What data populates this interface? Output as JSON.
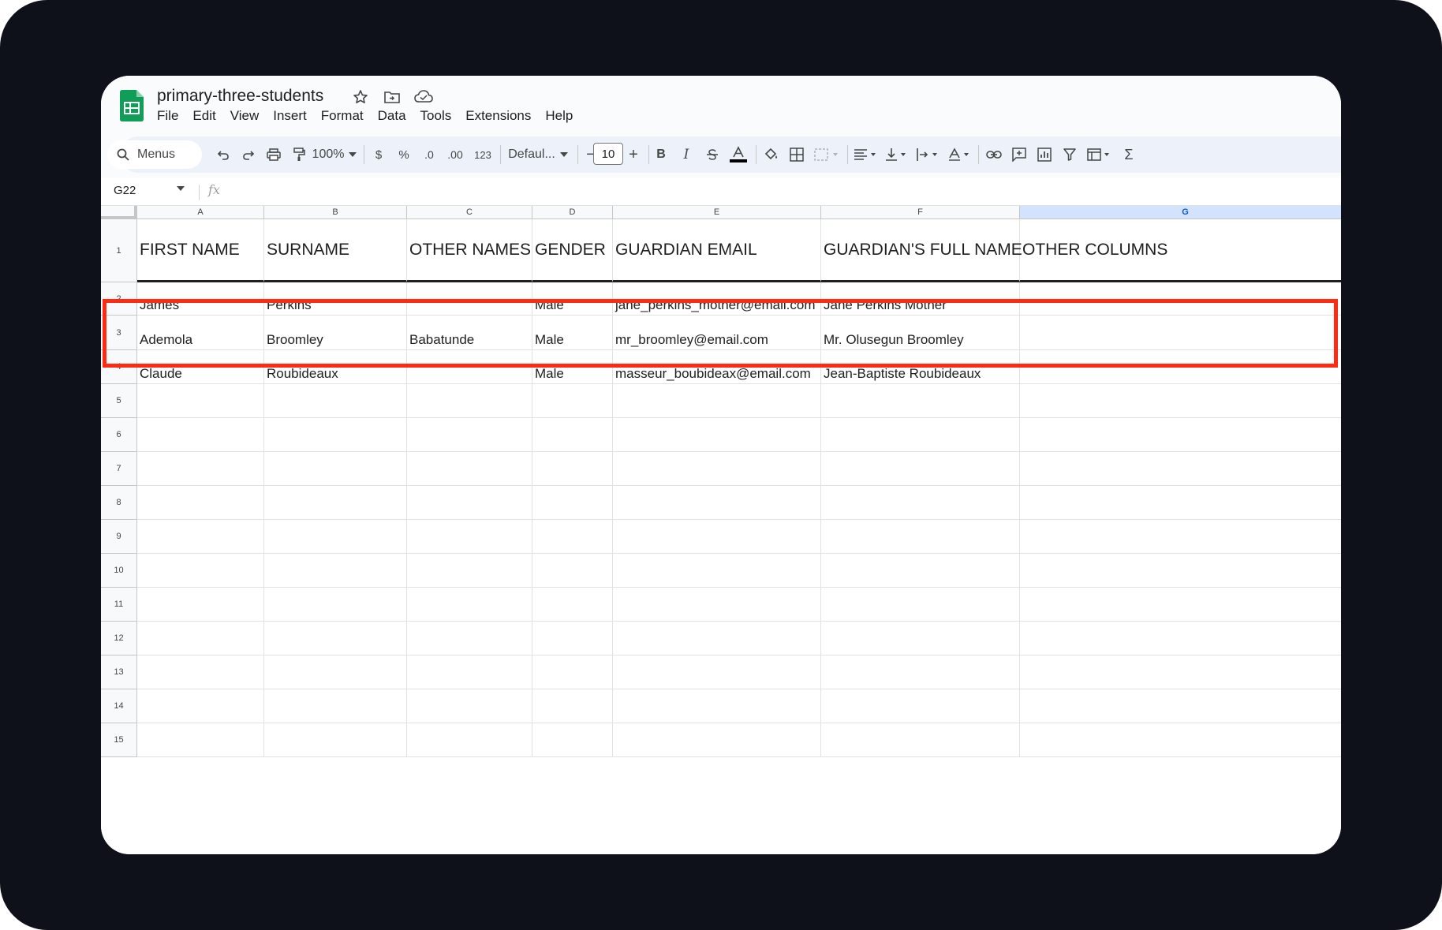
{
  "doc": {
    "title": "primary-three-students",
    "title_icons": [
      "star-icon",
      "move-to-folder-icon",
      "cloud-saved-icon"
    ]
  },
  "menu": [
    "File",
    "Edit",
    "View",
    "Insert",
    "Format",
    "Data",
    "Tools",
    "Extensions",
    "Help"
  ],
  "toolbar": {
    "menus_label": "Menus",
    "zoom": "100%",
    "currency": "$",
    "percent": "%",
    "decrease_decimal": ".0",
    "increase_decimal": ".00",
    "number_format": "123",
    "font": "Defaul...",
    "font_size": "10",
    "minus": "−",
    "plus": "+",
    "bold": "B",
    "italic": "I",
    "sigma": "Σ"
  },
  "formula_bar": {
    "name_box": "G22",
    "fx": "fx"
  },
  "columns": [
    "A",
    "B",
    "C",
    "D",
    "E",
    "F",
    "G"
  ],
  "selected_column": "G",
  "rows": [
    {
      "num": "1",
      "cells": [
        "FIRST NAME",
        "SURNAME",
        "OTHER NAMES",
        "GENDER",
        "GUARDIAN EMAIL",
        "GUARDIAN'S FULL NAME",
        "OTHER COLUMNS"
      ]
    },
    {
      "num": "2",
      "cells": [
        "James",
        "Perkins",
        "",
        "Male",
        "jane_perkins_mother@email.com",
        "Jane Perkins Mother",
        ""
      ]
    },
    {
      "num": "3",
      "cells": [
        "Ademola",
        "Broomley",
        "Babatunde",
        "Male",
        "mr_broomley@email.com",
        "Mr. Olusegun Broomley",
        ""
      ]
    },
    {
      "num": "4",
      "cells": [
        "Claude",
        "Roubideaux",
        "",
        "Male",
        "masseur_boubideax@email.com",
        "Jean-Baptiste Roubideaux",
        ""
      ]
    },
    {
      "num": "5",
      "cells": [
        "",
        "",
        "",
        "",
        "",
        "",
        ""
      ]
    },
    {
      "num": "6",
      "cells": [
        "",
        "",
        "",
        "",
        "",
        "",
        ""
      ]
    },
    {
      "num": "7",
      "cells": [
        "",
        "",
        "",
        "",
        "",
        "",
        ""
      ]
    },
    {
      "num": "8",
      "cells": [
        "",
        "",
        "",
        "",
        "",
        "",
        ""
      ]
    },
    {
      "num": "9",
      "cells": [
        "",
        "",
        "",
        "",
        "",
        "",
        ""
      ]
    },
    {
      "num": "10",
      "cells": [
        "",
        "",
        "",
        "",
        "",
        "",
        ""
      ]
    },
    {
      "num": "11",
      "cells": [
        "",
        "",
        "",
        "",
        "",
        "",
        ""
      ]
    },
    {
      "num": "12",
      "cells": [
        "",
        "",
        "",
        "",
        "",
        "",
        ""
      ]
    },
    {
      "num": "13",
      "cells": [
        "",
        "",
        "",
        "",
        "",
        "",
        ""
      ]
    },
    {
      "num": "14",
      "cells": [
        "",
        "",
        "",
        "",
        "",
        "",
        ""
      ]
    },
    {
      "num": "15",
      "cells": [
        "",
        "",
        "",
        "",
        "",
        "",
        ""
      ]
    }
  ],
  "colors": {
    "sheets_green": "#0f9d58",
    "highlight": "#ff2a12",
    "selection": "#d3e3fd"
  }
}
